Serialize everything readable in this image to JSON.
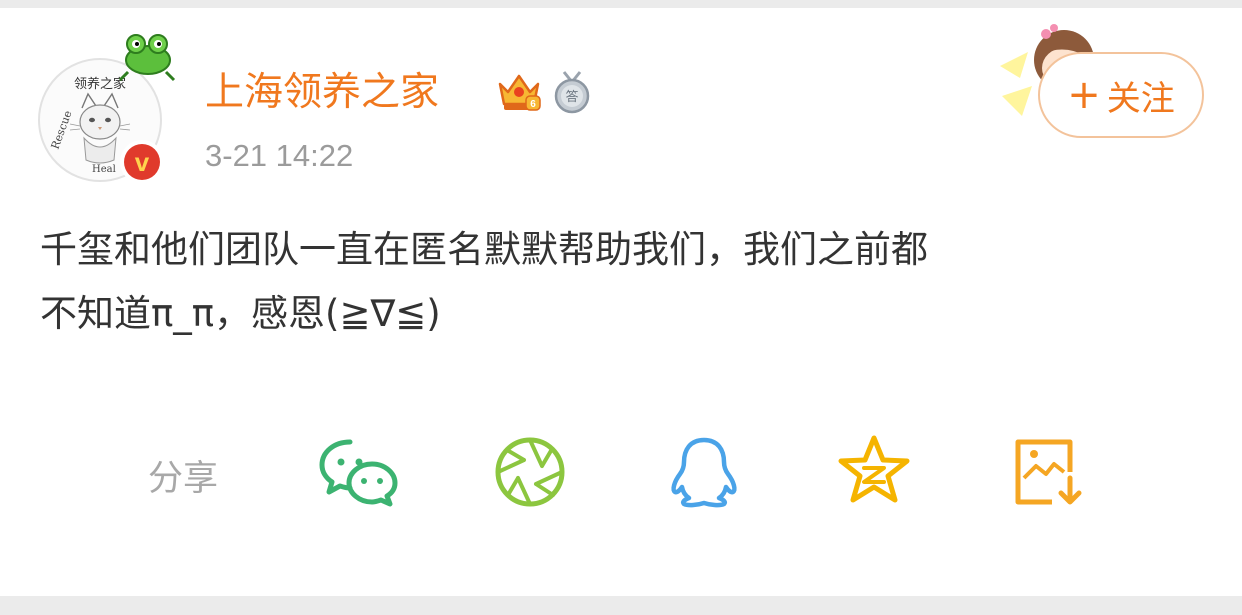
{
  "post": {
    "username": "上海领养之家",
    "timestamp": "3-21 14:22",
    "follow_label": "关注",
    "content": "千玺和他们团队一直在匿名默默帮助我们，我们之前都\n不知道π_π，感恩(≧∇≦)",
    "avatar_text": {
      "top": "领养之家",
      "left": "Rescue",
      "bottom": "Heal"
    }
  },
  "share": {
    "label": "分享",
    "targets": [
      "wechat-icon",
      "moments-icon",
      "qq-icon",
      "qzone-icon",
      "save-image-icon"
    ]
  },
  "colors": {
    "username": "#f0781e",
    "follow": "#f0781e",
    "verified": "#e03a2c",
    "wechat": "#3cb371",
    "moments": "#8cc63f",
    "qq": "#4aa3e8",
    "qzone": "#f5b400",
    "save": "#f5a623"
  }
}
